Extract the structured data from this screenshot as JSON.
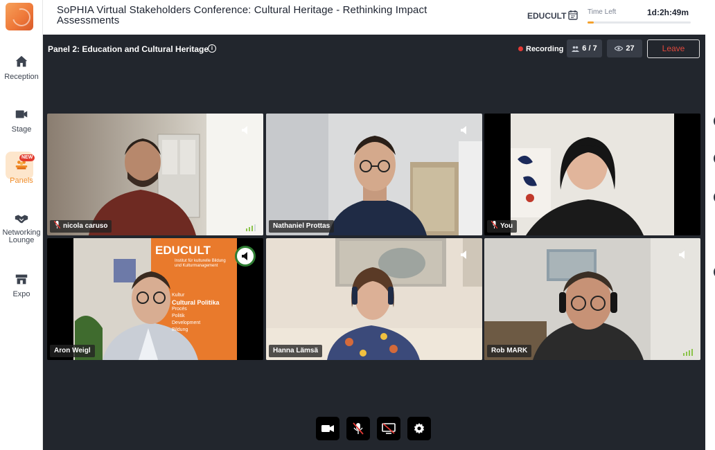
{
  "sidebar": {
    "items": [
      {
        "label": "Reception",
        "icon": "home-icon"
      },
      {
        "label": "Stage",
        "icon": "video-camera-icon"
      },
      {
        "label": "Panels",
        "icon": "panels-icon",
        "badge": "NEW",
        "active": true
      },
      {
        "label_line1": "Networking",
        "label_line2": "Lounge",
        "icon": "handshake-icon"
      },
      {
        "label": "Expo",
        "icon": "store-icon"
      }
    ]
  },
  "header": {
    "title": "SoPHIA Virtual Stakeholders Conference: Cultural Heritage - Rethinking Impact Assessments",
    "organizer": "EDUCULT",
    "time_left_label": "Time Left",
    "time_left_value": "1d:2h:49m",
    "time_progress": 0.06,
    "accent_color": "#f4a12b"
  },
  "session": {
    "panel_title": "Panel 2: Education and Cultural Heritage",
    "recording_label": "Recording",
    "participants": "6 / 7",
    "viewers": "27",
    "leave_label": "Leave"
  },
  "participants": [
    {
      "name": "nicola caruso",
      "muted": true
    },
    {
      "name": "Nathaniel Prottas",
      "muted": false
    },
    {
      "name": "You",
      "muted": true
    },
    {
      "name": "Aron Weigl",
      "muted": false,
      "speaking": true
    },
    {
      "name": "Hanna Lämsä",
      "muted": false
    },
    {
      "name": "Rob MARK",
      "muted": false
    }
  ],
  "banner": {
    "brand": "EDUCULT",
    "lines": [
      "Institut für kulturelle Bildung",
      "und Kulturmanagement"
    ],
    "words": [
      "Kultur",
      "Cultural Politika",
      "Procés",
      "Politik",
      "Development",
      "Bildung"
    ]
  },
  "controls": [
    {
      "icon": "camera-icon"
    },
    {
      "icon": "microphone-off-icon"
    },
    {
      "icon": "screen-share-off-icon"
    },
    {
      "icon": "settings-gear-icon"
    }
  ]
}
